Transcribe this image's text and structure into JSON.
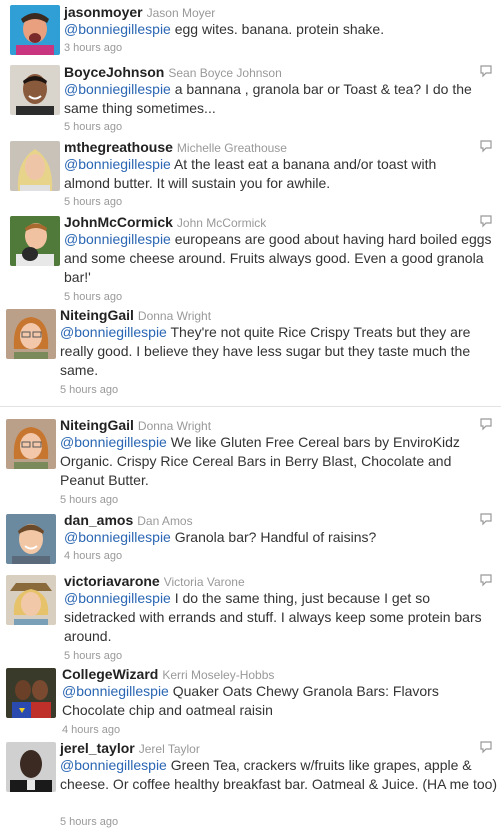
{
  "tweets": [
    {
      "username": "jasonmoyer",
      "realname": "Jason Moyer",
      "mention": "@bonniegillespie",
      "text": " egg wites. banana. protein shake.",
      "time": "3 hours ago"
    },
    {
      "username": "BoyceJohnson",
      "realname": "Sean Boyce Johnson",
      "mention": "@bonniegillespie",
      "text": " a bannana , granola bar or Toast & tea? I do the same thing sometimes...",
      "time": "5 hours ago"
    },
    {
      "username": "mthegreathouse",
      "realname": "Michelle Greathouse",
      "mention": "@bonniegillespie",
      "text": " At the least eat a banana and/or toast with almond butter. It will sustain you for awhile.",
      "time": "5 hours ago"
    },
    {
      "username": "JohnMcCormick",
      "realname": "John McCormick",
      "mention": "@bonniegillespie",
      "text": " europeans are good about having hard boiled eggs and some cheese around. Fruits always good. Even a good granola bar!'",
      "time": "5 hours ago"
    },
    {
      "username": "NiteingGail",
      "realname": "Donna Wright",
      "mention": "@bonniegillespie",
      "text": " They're not quite Rice Crispy Treats but they are really good. I believe they have less sugar but they taste much the same.",
      "time": "5 hours ago"
    },
    {
      "username": "NiteingGail",
      "realname": "Donna Wright",
      "mention": "@bonniegillespie",
      "text": " We like Gluten Free Cereal bars by EnviroKidz Organic. Crispy Rice Cereal Bars in Berry Blast, Chocolate and Peanut Butter.",
      "time": "5 hours ago"
    },
    {
      "username": "dan_amos",
      "realname": "Dan Amos",
      "mention": "@bonniegillespie",
      "text": " Granola bar? Handful of raisins?",
      "time": "4 hours ago"
    },
    {
      "username": "victoriavarone",
      "realname": "Victoria Varone",
      "mention": "@bonniegillespie",
      "text": " I do the same thing, just because I get so sidetracked with errands and stuff. I always keep some protein bars around.",
      "time": "5 hours ago"
    },
    {
      "username": "CollegeWizard",
      "realname": "Kerri Moseley-Hobbs",
      "mention": "@bonniegillespie",
      "text": " Quaker Oats Chewy Granola Bars: Flavors Chocolate chip and oatmeal raisin",
      "time": "4 hours ago"
    },
    {
      "username": "jerel_taylor",
      "realname": "Jerel Taylor",
      "mention": "@bonniegillespie",
      "text": " Green Tea, crackers w/fruits like grapes, apple & cheese. Or coffee healthy breakfast bar. Oatmeal & Juice. (HA me too)",
      "time": "5 hours ago"
    }
  ],
  "icons": {
    "reply": "reply-icon"
  },
  "colors": {
    "mention": "#2a66b3",
    "meta": "#999999",
    "username": "#222222"
  }
}
